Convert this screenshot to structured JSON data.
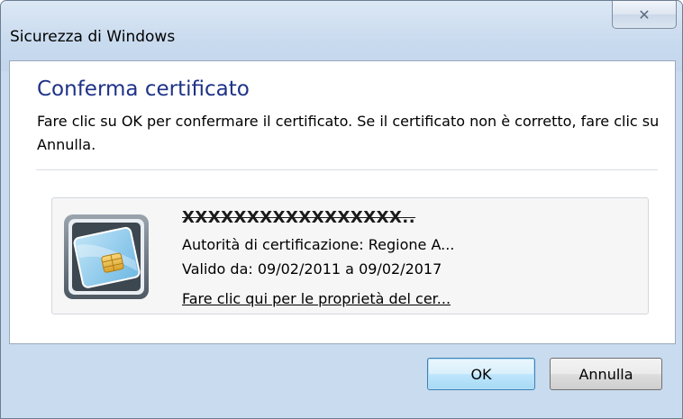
{
  "window": {
    "title": "Sicurezza di Windows",
    "close_symbol": "✕"
  },
  "dialog": {
    "heading": "Conferma certificato",
    "instruction": "Fare clic su OK per confermare il certificato. Se il certificato non è corretto, fare clic su Annulla."
  },
  "certificate": {
    "icon": "smart-card-icon",
    "name": "XXXXXXXXXXXXXXXXX..",
    "issuer": "Autorità di certificazione: Regione A...",
    "validity": "Valido da: 09/02/2011 a 09/02/2017",
    "properties_link": "Fare clic qui per le proprietà del cer..."
  },
  "buttons": {
    "ok": "OK",
    "cancel": "Annulla"
  },
  "colors": {
    "heading": "#1e3287",
    "chrome": "#c9dbef",
    "ok_border": "#3c7fb1"
  }
}
